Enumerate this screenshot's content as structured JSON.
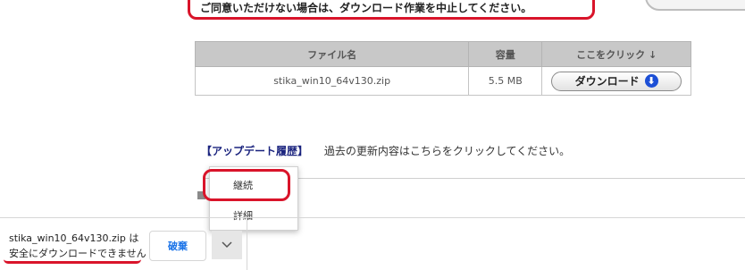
{
  "notice": {
    "text": "ご同意いただけない場合は、ダウンロード作業を中止してください。"
  },
  "table": {
    "headers": [
      "ファイル名",
      "容量",
      "ここをクリック ↓"
    ],
    "row": {
      "filename": "stika_win10_64v130.zip",
      "size": "5.5 MB",
      "button_label": "ダウンロード"
    }
  },
  "history": {
    "link": "【アップデート履歴】",
    "text": "過去の更新内容はこちらをクリックしてください。"
  },
  "context_menu": {
    "items": [
      "継続",
      "詳細"
    ]
  },
  "download_shelf": {
    "line1": "stika_win10_64v130.zip は",
    "line2": "安全にダウンロードできません",
    "discard_label": "破棄"
  },
  "colors": {
    "highlight": "#d9142a",
    "link": "#1a237e",
    "button_text": "#1a73e8",
    "download_icon": "#1c4fd6"
  },
  "icons": {
    "download": "arrow-down-circle-icon",
    "menu": "chevron-down-icon"
  }
}
